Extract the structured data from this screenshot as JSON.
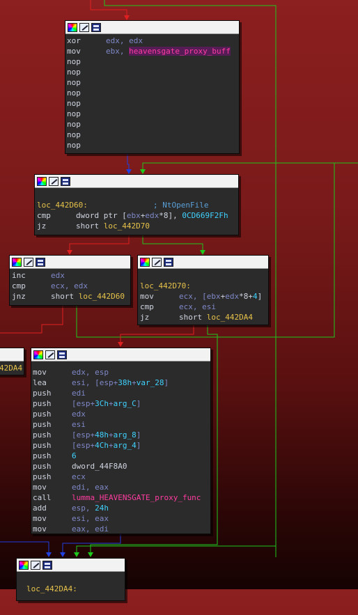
{
  "colors": {
    "background_top": "#8c1f1f",
    "background_bottom": "#160303",
    "node_bg": "#2b2b2b",
    "header_bg": "#f2f2f2",
    "mnemonic": "#cfd4e0",
    "register": "#7f88c8",
    "symbol": "#ff3ca0",
    "label": "#e6c24a",
    "number": "#3fd2ff",
    "comment": "#5aa0d8",
    "edge_true": "#1ec81e",
    "edge_false": "#e02020",
    "edge_unconditional": "#2040e0"
  },
  "header_icons": [
    "color-picker-icon",
    "rename-icon",
    "graph-view-icon"
  ],
  "nodes": {
    "block1": {
      "lines": [
        {
          "m": "xor",
          "a": "edx",
          "b": ", edx"
        },
        {
          "m": "mov",
          "a": "ebx",
          "b": ", ",
          "s": "heavensgate_proxy_buff"
        },
        {
          "m": "nop"
        },
        {
          "m": "nop"
        },
        {
          "m": "nop"
        },
        {
          "m": "nop"
        },
        {
          "m": "nop"
        },
        {
          "m": "nop"
        },
        {
          "m": "nop"
        },
        {
          "m": "nop"
        },
        {
          "m": "nop"
        }
      ]
    },
    "block2": {
      "label": "loc_442D60:",
      "comment": "; NtOpenFile",
      "cmp_mn": "cmp",
      "cmp_a": "dword ptr [",
      "cmp_r1": "ebx",
      "cmp_p": "+",
      "cmp_r2": "edx",
      "cmp_c": "*8], ",
      "cmp_n": "0CD669F2Fh",
      "jz_mn": "jz",
      "jz_short": "short ",
      "jz_target": "loc_442D70"
    },
    "block3": {
      "l1_m": "inc",
      "l1_a": "edx",
      "l2_m": "cmp",
      "l2_a": "ecx, edx",
      "l3_m": "jnz",
      "l3_short": "short ",
      "l3_target": "loc_442D60"
    },
    "block4": {
      "label": "loc_442D70:",
      "l1_m": "mov",
      "l1_a": "ecx, [",
      "l1_r1": "ebx",
      "l1_p": "+",
      "l1_r2": "edx",
      "l1_c": "*8+",
      "l1_n": "4",
      "l1_e": "]",
      "l2_m": "cmp",
      "l2_a": "ecx, esi",
      "l3_m": "jz",
      "l3_short": "short ",
      "l3_target": "loc_442DA4"
    },
    "block5": {
      "lines": [
        {
          "m": "mov",
          "parts": [
            {
              "t": "edx, esp",
              "c": "reg"
            }
          ]
        },
        {
          "m": "lea",
          "parts": [
            {
              "t": "esi, [esp+",
              "c": "reg"
            },
            {
              "t": "38h",
              "c": "num"
            },
            {
              "t": "+",
              "c": "reg"
            },
            {
              "t": "var_28",
              "c": "num"
            },
            {
              "t": "]",
              "c": "reg"
            }
          ]
        },
        {
          "m": "push",
          "parts": [
            {
              "t": "edi",
              "c": "reg"
            }
          ]
        },
        {
          "m": "push",
          "parts": [
            {
              "t": "[esp+",
              "c": "reg"
            },
            {
              "t": "3Ch",
              "c": "num"
            },
            {
              "t": "+",
              "c": "reg"
            },
            {
              "t": "arg_C",
              "c": "num"
            },
            {
              "t": "]",
              "c": "reg"
            }
          ]
        },
        {
          "m": "push",
          "parts": [
            {
              "t": "edx",
              "c": "reg"
            }
          ]
        },
        {
          "m": "push",
          "parts": [
            {
              "t": "esi",
              "c": "reg"
            }
          ]
        },
        {
          "m": "push",
          "parts": [
            {
              "t": "[esp+",
              "c": "reg"
            },
            {
              "t": "48h",
              "c": "num"
            },
            {
              "t": "+",
              "c": "reg"
            },
            {
              "t": "arg_8",
              "c": "num"
            },
            {
              "t": "]",
              "c": "reg"
            }
          ]
        },
        {
          "m": "push",
          "parts": [
            {
              "t": "[esp+",
              "c": "reg"
            },
            {
              "t": "4Ch",
              "c": "num"
            },
            {
              "t": "+",
              "c": "reg"
            },
            {
              "t": "arg_4",
              "c": "num"
            },
            {
              "t": "]",
              "c": "reg"
            }
          ]
        },
        {
          "m": "push",
          "parts": [
            {
              "t": "6",
              "c": "num"
            }
          ]
        },
        {
          "m": "push",
          "parts": [
            {
              "t": "dword_44F8A0",
              "c": "mn"
            }
          ]
        },
        {
          "m": "push",
          "parts": [
            {
              "t": "ecx",
              "c": "reg"
            }
          ]
        },
        {
          "m": "mov",
          "parts": [
            {
              "t": "edi, eax",
              "c": "reg"
            }
          ]
        },
        {
          "m": "call",
          "parts": [
            {
              "t": "lumma_HEAVENSGATE_proxy_func",
              "c": "sym"
            }
          ]
        },
        {
          "m": "add",
          "parts": [
            {
              "t": "esp, ",
              "c": "reg"
            },
            {
              "t": "24h",
              "c": "num"
            }
          ]
        },
        {
          "m": "mov",
          "parts": [
            {
              "t": "esi, eax",
              "c": "reg"
            }
          ]
        },
        {
          "m": "mov",
          "parts": [
            {
              "t": "eax, edi",
              "c": "reg"
            }
          ]
        }
      ]
    },
    "block6": {
      "label": "loc_442DA4:"
    },
    "partial_left": {
      "text": "42DA4"
    }
  }
}
